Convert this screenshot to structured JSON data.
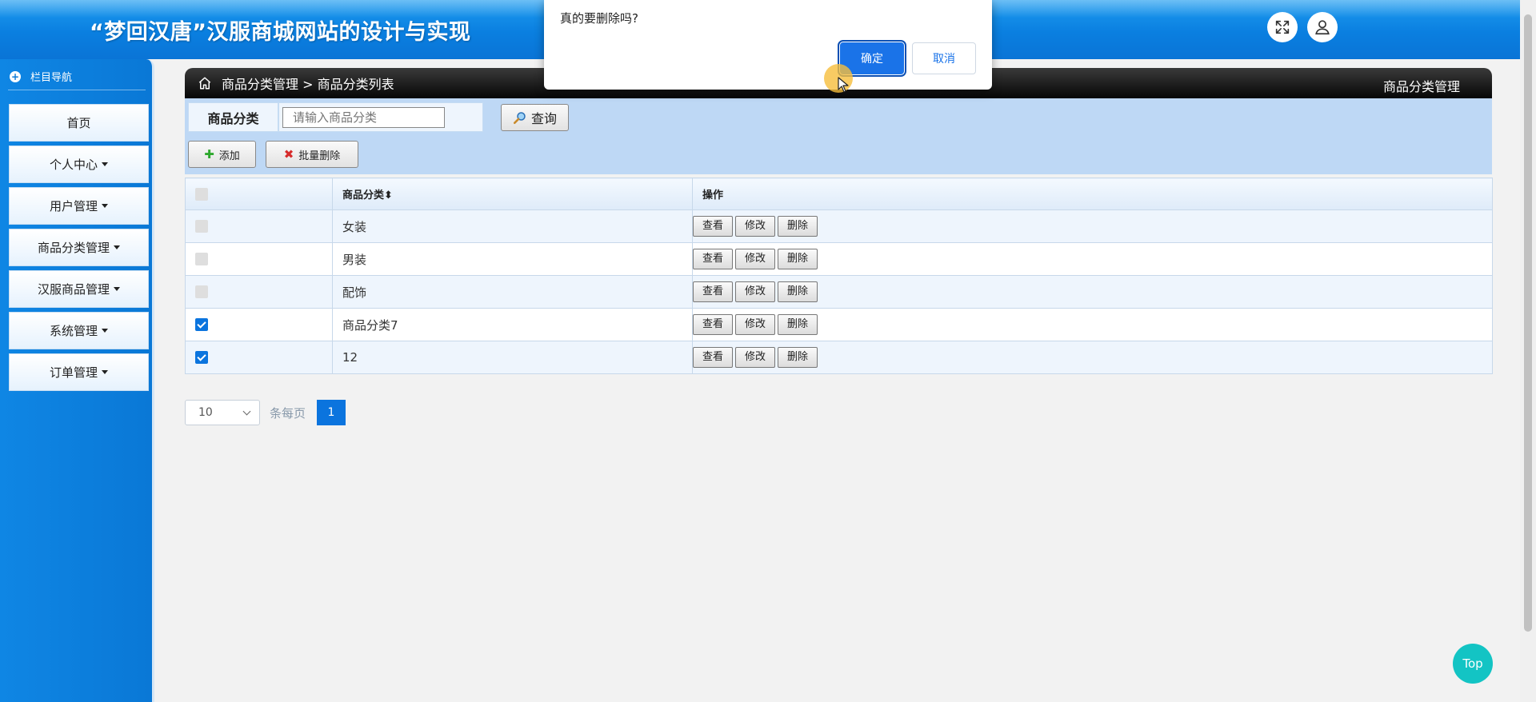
{
  "header": {
    "title": "“梦回汉唐”汉服商城网站的设计与实现",
    "fullscreen_icon": "fullscreen-icon",
    "user_icon": "user-icon"
  },
  "sidebar": {
    "heading": "栏目导航",
    "items": [
      {
        "label": "首页",
        "has_caret": false
      },
      {
        "label": "个人中心",
        "has_caret": true
      },
      {
        "label": "用户管理",
        "has_caret": true
      },
      {
        "label": "商品分类管理",
        "has_caret": true
      },
      {
        "label": "汉服商品管理",
        "has_caret": true
      },
      {
        "label": "系统管理",
        "has_caret": true
      },
      {
        "label": "订单管理",
        "has_caret": true
      }
    ]
  },
  "breadcrumb": {
    "path": "商品分类管理 > 商品分类列表",
    "right_title": "商品分类管理"
  },
  "search": {
    "label": "商品分类",
    "placeholder": "请输入商品分类",
    "query_label": "查询"
  },
  "toolbar": {
    "add_label": "添加",
    "batch_delete_label": "批量删除"
  },
  "table": {
    "columns": [
      "商品分类",
      "操作"
    ],
    "sort_glyph": "⬍",
    "rows": [
      {
        "name": "女装",
        "checked": false
      },
      {
        "name": "男装",
        "checked": false
      },
      {
        "name": "配饰",
        "checked": false
      },
      {
        "name": "商品分类7",
        "checked": true
      },
      {
        "name": "12",
        "checked": true
      }
    ],
    "actions": [
      "查看",
      "修改",
      "删除"
    ]
  },
  "pagination": {
    "page_size": "10",
    "per_page_label": "条每页",
    "current_page": "1"
  },
  "dialog": {
    "message": "真的要删除吗?",
    "confirm_label": "确定",
    "cancel_label": "取消"
  },
  "back_to_top": "Top",
  "colors": {
    "primary": "#0b74de",
    "header": "#0a7fe0",
    "toolbar": "#bed8f5",
    "top_button": "#13c4c4"
  }
}
